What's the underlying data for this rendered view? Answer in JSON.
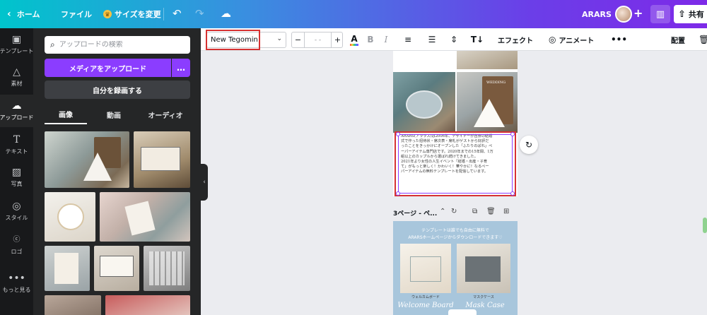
{
  "topbar": {
    "home_label": "ホーム",
    "file_label": "ファイル",
    "resize_label": "サイズを変更",
    "brand_name": "ARARS",
    "share_label": "共有",
    "colors": {
      "gradient_start": "#00c4cc",
      "gradient_end": "#7d2ae8"
    }
  },
  "rail": {
    "items": [
      {
        "label": "テンプレート",
        "icon": "layout-icon"
      },
      {
        "label": "素材",
        "icon": "shapes-icon"
      },
      {
        "label": "アップロード",
        "icon": "cloud-upload-icon"
      },
      {
        "label": "テキスト",
        "icon": "text-icon"
      },
      {
        "label": "写真",
        "icon": "image-icon"
      },
      {
        "label": "スタイル",
        "icon": "palette-icon"
      },
      {
        "label": "ロゴ",
        "icon": "logo-icon"
      },
      {
        "label": "もっと見る",
        "icon": "more-icon"
      }
    ],
    "active_index": 2
  },
  "panel": {
    "search_placeholder": "アップロードの検索",
    "upload_button": "メディアをアップロード",
    "upload_more": "…",
    "record_button": "自分を録画する",
    "tabs": [
      "画像",
      "動画",
      "オーディオ"
    ],
    "active_tab": 0
  },
  "toolbar": {
    "font_name": "New Tegomin",
    "font_size": "- -",
    "size_minus": "−",
    "size_plus": "+",
    "text_color_glyph": "A",
    "bold_glyph": "B",
    "italic_glyph": "I",
    "effect_label": "エフェクト",
    "animate_label": "アニメート",
    "more_glyph": "•••",
    "position_label": "配置"
  },
  "canvas": {
    "text_lines": [
      "ARARS(アララス)は2006年、デザイナーが自身の結婚",
      "式で作った招待状・席次表・席札がゲストから好評だ",
      "ったことをきっかけにオープンした「ふたりのぱれ」ペ",
      "ーパーアイテム専門店です。2020年までの15年間、1万",
      "組以上のカップルから選ばれ続けてきました。",
      "2021年より女性の人生イベント「結婚・出産・子育",
      "て」がもっと楽しく！かわいく！華やかに！なるペー",
      "パーアイテムの無料テンプレートを配信しています。"
    ],
    "photo_sign_text": "WEDDING",
    "page3_title": "3ページ - ペ...",
    "page3_lines": [
      "テンプレートは誰でも自由に無料で",
      "ARARSホームページからダウンロードできます♡"
    ],
    "card_left_caption": "ウェルカムボード",
    "card_right_caption": "マスクケース",
    "card_left_script": "Welcome Board",
    "card_right_script": "Mask Case"
  }
}
